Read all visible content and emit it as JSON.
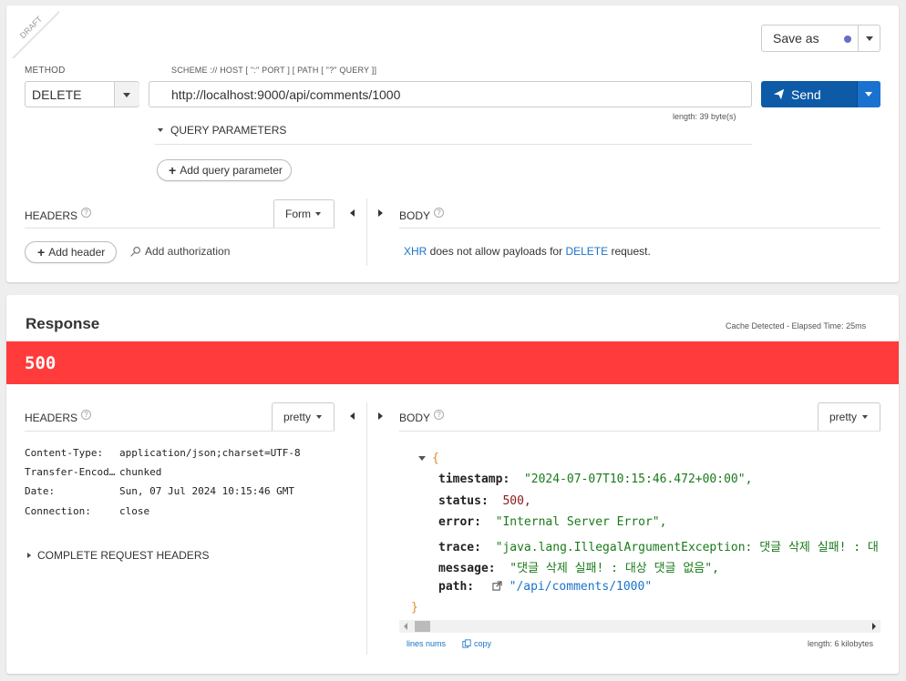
{
  "request": {
    "draft_label": "DRAFT",
    "save_as_label": "Save as",
    "method_label": "METHOD",
    "method_value": "DELETE",
    "url_label": "SCHEME :// HOST [ \":\" PORT ] [ PATH [ \"?\" QUERY ]]",
    "url_value": "http://localhost:9000/api/comments/1000",
    "url_length": "length: 39 byte(s)",
    "send_label": "Send",
    "query_params_label": "QUERY PARAMETERS",
    "add_query_param_label": "Add query parameter",
    "headers_label": "HEADERS",
    "headers_mode": "Form",
    "add_header_label": "Add header",
    "add_authorization_label": "Add authorization",
    "body_label": "BODY",
    "body_notice_xhr": "XHR",
    "body_notice_mid": " does not allow payloads for ",
    "body_notice_method": "DELETE",
    "body_notice_end": " request."
  },
  "response": {
    "title": "Response",
    "cache_info": "Cache Detected - Elapsed Time: 25ms",
    "status_code": "500",
    "status_color": "#ff3b3b",
    "headers_label": "HEADERS",
    "headers_mode": "pretty",
    "body_label": "BODY",
    "body_mode": "pretty",
    "headers": [
      {
        "name": "Content-Type:",
        "value": "application/json;charset=UTF-8"
      },
      {
        "name": "Transfer-Encod…",
        "value": "chunked"
      },
      {
        "name": "Date:",
        "value": "Sun, 07 Jul 2024 10:15:46 GMT"
      },
      {
        "name": "Connection:",
        "value": "close"
      }
    ],
    "complete_headers_label": "COMPLETE REQUEST HEADERS",
    "json": {
      "open_brace": "{",
      "close_brace": "}",
      "timestamp_key": "timestamp:",
      "timestamp_val": "\"2024-07-07T10:15:46.472+00:00\",",
      "status_key": "status:",
      "status_val": "500,",
      "error_key": "error:",
      "error_val": "\"Internal Server Error\",",
      "trace_key": "trace:",
      "trace_val": "\"java.lang.IllegalArgumentException: 댓글 삭제 실패! : 대",
      "message_key": "message:",
      "message_val": "\"댓글 삭제 실패! : 대상 댓글 없음\",",
      "path_key": "path:",
      "path_val": "\"/api/comments/1000\""
    },
    "lines_nums_label": "lines nums",
    "copy_label": "copy",
    "length_label": "length: 6 kilobytes"
  },
  "colors": {
    "primary": "#0d5aa7",
    "status_error": "#ff3b3b",
    "link": "#1a73c9"
  }
}
